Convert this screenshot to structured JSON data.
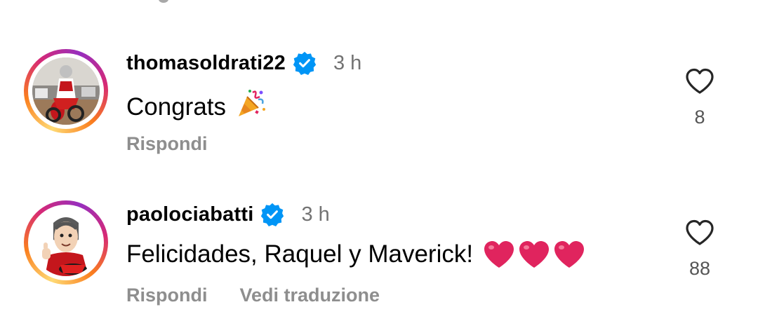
{
  "colors": {
    "time_text": "#737373",
    "action_text": "#8e8e8e",
    "verified_badge": "#0095f6",
    "story_ring_start": "#feda75",
    "story_ring_end": "#962fbf",
    "heart_outline": "#262626",
    "heart_emoji": "#e0245e"
  },
  "comments": [
    {
      "username": "thomasoldrati22",
      "verified": true,
      "time": "3 h",
      "text": "Congrats",
      "emoji": "party-popper",
      "actions": [
        "Rispondi"
      ],
      "likes": "8",
      "avatar_icon": "motocross-rider-avatar",
      "like_icon": "heart-outline-icon"
    },
    {
      "username": "paolociabatti",
      "verified": true,
      "time": "3 h",
      "text": "Felicidades, Raquel y Maverick!",
      "emoji": "red-heart x3",
      "actions": [
        "Rispondi",
        "Vedi traduzione"
      ],
      "likes": "88",
      "avatar_icon": "cartoon-caricature-avatar",
      "like_icon": "heart-outline-icon"
    }
  ]
}
